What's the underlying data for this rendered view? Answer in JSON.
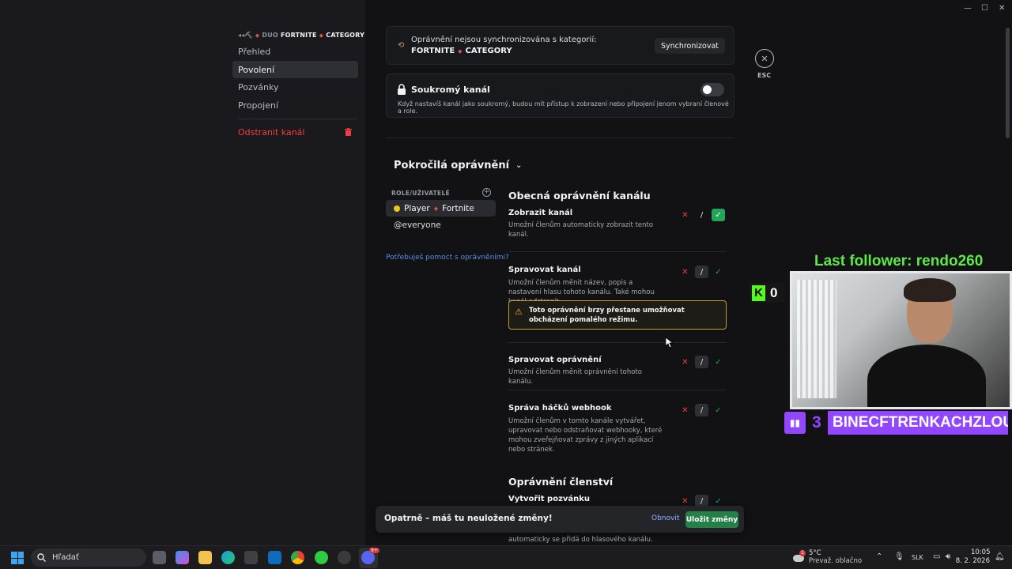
{
  "breadcrumb": {
    "prefix": "DUO",
    "category_left": "FORTNITE",
    "category_right": "CATEGORY"
  },
  "sidebar": {
    "items": [
      {
        "label": "Přehled"
      },
      {
        "label": "Povolení"
      },
      {
        "label": "Pozvánky"
      },
      {
        "label": "Propojení"
      }
    ],
    "delete_label": "Odstranit kanál"
  },
  "sync": {
    "line1": "Oprávnění nejsou synchronizována s kategorií:",
    "cat_left": "FORTNITE",
    "cat_right": "CATEGORY",
    "button": "Synchronizovat"
  },
  "private": {
    "title": "Soukromý kanál",
    "desc": "Když nastavíš kanál jako soukromý, budou mít přístup k zobrazení nebo připojení jenom vybraní členové a role.",
    "enabled": false
  },
  "advanced": {
    "title": "Pokročilá oprávnění",
    "roles_header": "ROLE/UŽIVATELÉ",
    "roles": [
      {
        "name_a": "Player",
        "name_b": "Fortnite",
        "color": "#f0c419"
      },
      {
        "name": "@everyone"
      }
    ],
    "help_link": "Potřebuješ pomoct s oprávněními?"
  },
  "sections": {
    "general": "Obecná oprávnění kanálu",
    "membership": "Oprávnění členství"
  },
  "permissions": [
    {
      "title": "Zobrazit kanál",
      "desc": "Umožní členům automaticky zobrazit tento kanál.",
      "state": "allow"
    },
    {
      "title": "Spravovat kanál",
      "desc": "Umožní členům měnit název, popis a nastavení hlasu tohoto kanálu. Také mohou kanál odstranit.",
      "state": "neutral"
    },
    {
      "title": "Spravovat oprávnění",
      "desc": "Umožní členům měnit oprávnění tohoto kanálu.",
      "state": "neutral"
    },
    {
      "title": "Správa háčků webhook",
      "desc": "Umožní členům v tomto kanále vytvářet, upravovat nebo odstraňovat webhooky, které mohou zveřejňovat zprávy z jiných aplikací nebo stránek.",
      "state": "neutral"
    },
    {
      "title": "Vytvořit pozvánku",
      "state": "neutral"
    }
  ],
  "warning": "Toto oprávnění brzy přestane umožňovat obcházení pomalého režimu.",
  "symbols": {
    "deny": "✕",
    "neutral": "/",
    "allow": "✓"
  },
  "esc_label": "ESC",
  "unsaved": {
    "message": "Opatrně – máš tu neuložené změny!",
    "reset": "Obnovit",
    "save": "Uložit změny",
    "behind_text": "automaticky se přidá do hlasového kanálu."
  },
  "overlay": {
    "last_follower": "Last follower: rendo260",
    "kick_count": "0",
    "twitch_count": "3",
    "twitch_name": "BINECFTRENKACHZLOUN"
  },
  "taskbar": {
    "search_placeholder": "Hľadať",
    "weather_temp": "5°C",
    "weather_desc": "Prevaž. oblačno",
    "weather_badge": "1",
    "lang": "SLK",
    "time": "10:05",
    "date": "8. 2. 2026",
    "discord_badge": "9+"
  },
  "colors": {
    "accent_green": "#248046",
    "danger": "#f23f43",
    "link": "#5a8ee8",
    "warning": "#f0b232",
    "follower_green": "#5fe84b",
    "twitch_purple": "#9146ff",
    "kick_green": "#53fc18"
  }
}
